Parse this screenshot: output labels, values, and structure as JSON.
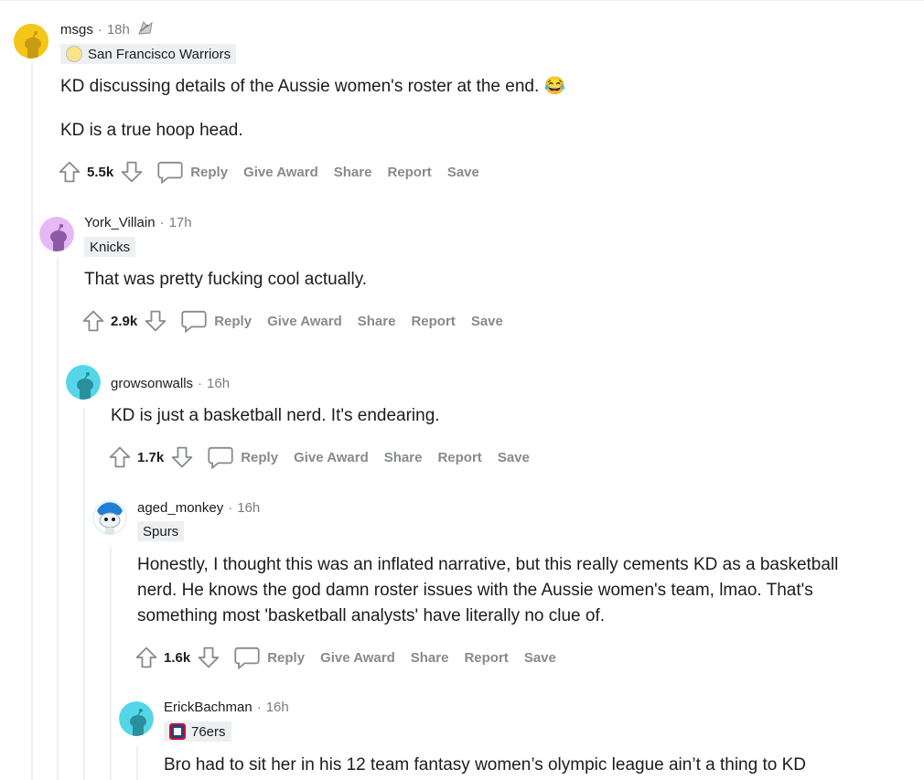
{
  "comments": [
    {
      "username": "msgs",
      "time": "18h",
      "flair": "San Francisco Warriors",
      "body": [
        "KD discussing details of the Aussie women's roster at the end. 😂",
        "KD is a true hoop head."
      ],
      "score": "5.5k",
      "actions": {
        "reply": "Reply",
        "award": "Give Award",
        "share": "Share",
        "report": "Report",
        "save": "Save"
      },
      "avatar_color": "#f5c518"
    },
    {
      "username": "York_Villain",
      "time": "17h",
      "flair": "Knicks",
      "body": [
        "That was pretty fucking cool actually."
      ],
      "score": "2.9k",
      "actions": {
        "reply": "Reply",
        "award": "Give Award",
        "share": "Share",
        "report": "Report",
        "save": "Save"
      },
      "avatar_color": "#d7a2f0"
    },
    {
      "username": "growsonwalls",
      "time": "16h",
      "flair": "",
      "body": [
        "KD is just a basketball nerd. It's endearing."
      ],
      "score": "1.7k",
      "actions": {
        "reply": "Reply",
        "award": "Give Award",
        "share": "Share",
        "report": "Report",
        "save": "Save"
      },
      "avatar_color": "#54d6e8"
    },
    {
      "username": "aged_monkey",
      "time": "16h",
      "flair": "Spurs",
      "body": [
        "Honestly, I thought this was an inflated narrative, but this really cements KD as a basketball nerd. He knows the god damn roster issues with the Aussie women's team, lmao. That's something most 'basketball analysts' have literally no clue of."
      ],
      "score": "1.6k",
      "actions": {
        "reply": "Reply",
        "award": "Give Award",
        "share": "Share",
        "report": "Report",
        "save": "Save"
      },
      "avatar_color": "#ffffff"
    },
    {
      "username": "ErickBachman",
      "time": "16h",
      "flair": "76ers",
      "body": [
        "Bro had to sit her in his 12 team fantasy women’s olympic league ain’t a thing to KD"
      ],
      "score": "",
      "actions": {},
      "avatar_color": "#54d6e8"
    }
  ],
  "icons": {
    "upvote": "arrow-up-icon",
    "downvote": "arrow-down-icon",
    "reply": "speech-bubble-icon",
    "award": "award-icon"
  },
  "colors": {
    "rail": "#edeff1",
    "action_text": "#878a8c",
    "meta_text": "#7c7c7c"
  }
}
